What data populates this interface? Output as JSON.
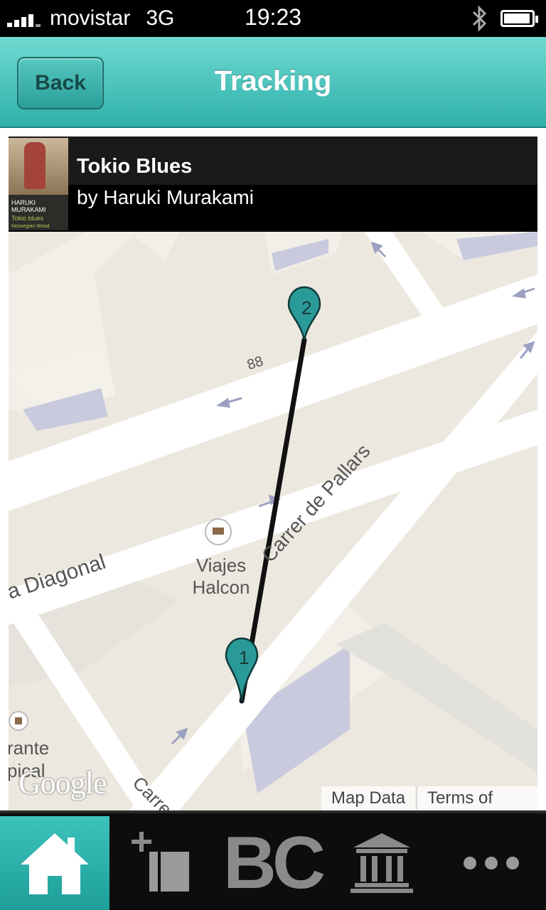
{
  "status_bar": {
    "carrier": "movistar",
    "network": "3G",
    "time": "19:23",
    "bluetooth_icon": "bluetooth-icon",
    "battery_icon": "battery-icon"
  },
  "nav": {
    "back_label": "Back",
    "title": "Tracking"
  },
  "book": {
    "title": "Tokio Blues",
    "author": "by Haruki Murakami",
    "cover": {
      "author_line1": "HARUKI",
      "author_line2": "MURAKAMI",
      "title_line1": "Tokio blues",
      "title_line2": "Norwegian Wood"
    }
  },
  "map": {
    "street_labels": {
      "route_number": "88",
      "diagonal": "a Diagonal",
      "pallars": "Carrer de Pallars",
      "carrer_partial": "Carre",
      "poi_line1": "Viajes",
      "poi_line2": "Halcon",
      "poi2_line1": "rante",
      "poi2_line2": "pical"
    },
    "markers": [
      {
        "label": "2"
      },
      {
        "label": "1"
      }
    ],
    "map_data_label": "Map Data",
    "terms_label": "Terms of Use",
    "google_label": "Google"
  },
  "tab_bar": {
    "tabs": [
      {
        "icon": "home-icon",
        "active": true
      },
      {
        "icon": "add-book-icon",
        "active": false
      },
      {
        "icon": "bc-logo-icon",
        "label": "BC",
        "active": false
      },
      {
        "icon": "library-icon",
        "active": false
      },
      {
        "icon": "more-icon",
        "active": false
      }
    ]
  },
  "colors": {
    "accent": "#2fb0aa",
    "marker": "#2a9a98"
  }
}
